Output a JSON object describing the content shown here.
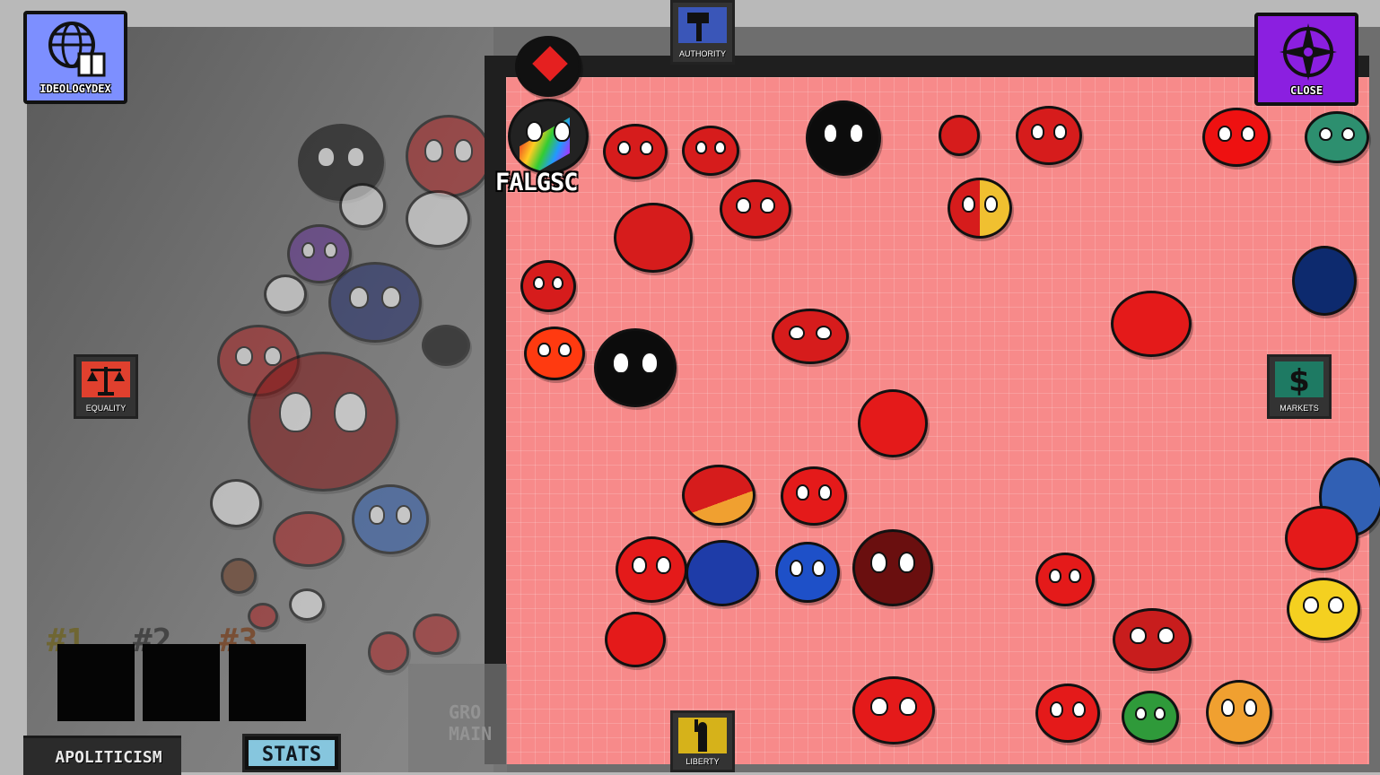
{
  "buttons": {
    "ideologydex_label": "IDEOLOGYDEX",
    "close_label": "CLOSE",
    "stats_label": "STATS"
  },
  "axes": {
    "authority": "AUTHORITY",
    "liberty": "LIBERTY",
    "equality": "EQUALITY",
    "markets": "MARKETS"
  },
  "selected_ball_label": "FALGSC",
  "comparison_slots": [
    "#1",
    "#2",
    "#3"
  ],
  "bottom_bar": {
    "current_ideology": "APOLITICISM"
  },
  "obscured_text": "GRO\nMAIN",
  "colors": {
    "compass_bg": "#f78a8a",
    "ideologydex_button": "#7d8fff",
    "close_button": "#8b1fe0",
    "equality_icon": "#e0402e",
    "markets_icon": "#1e7a63",
    "authority_icon": "#3a56b8",
    "liberty_icon": "#d6b21a",
    "stats_button": "#86c6de"
  },
  "icons": {
    "ideologydex": "globe-book-icon",
    "close": "compass-icon",
    "authority": "hammer-icon",
    "liberty": "statue-of-liberty-icon",
    "equality": "scales-icon",
    "markets": "dollar-icon"
  }
}
